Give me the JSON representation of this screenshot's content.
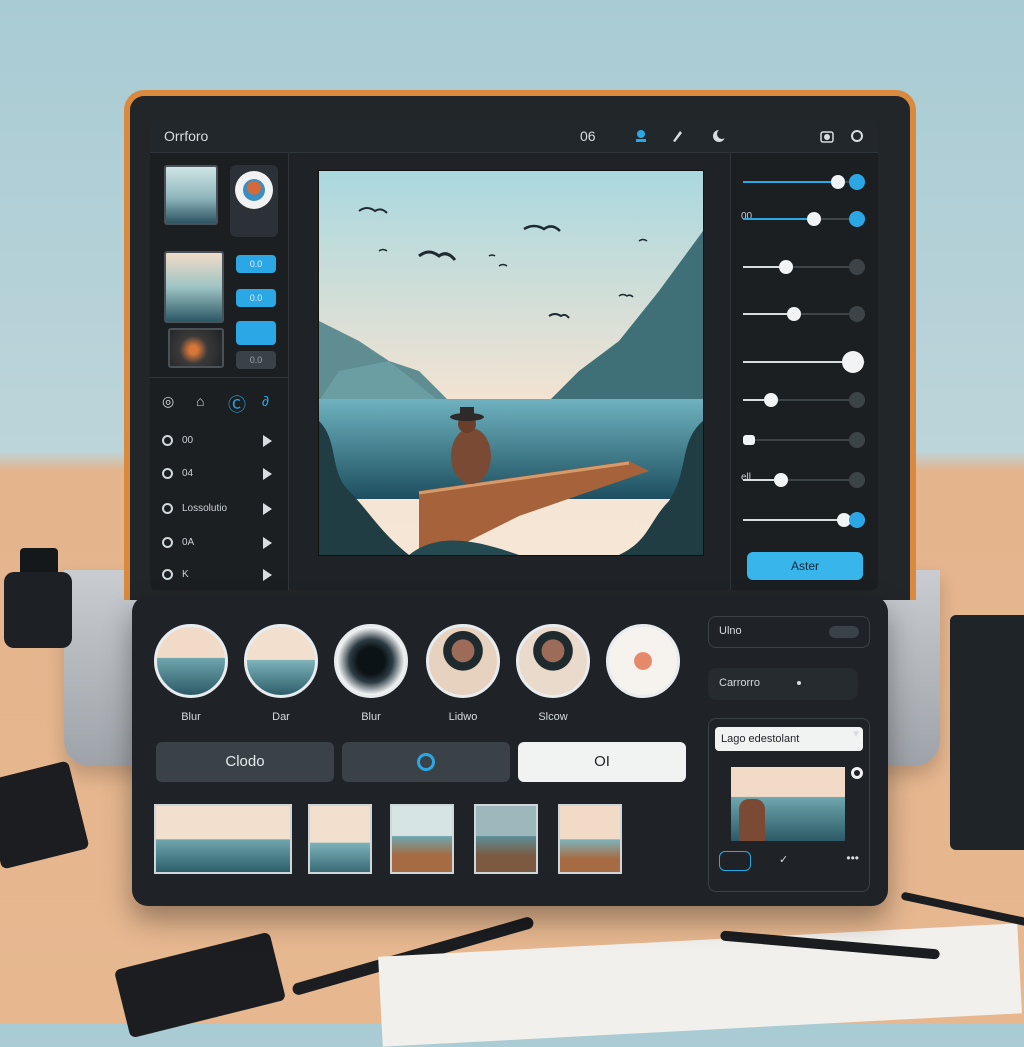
{
  "app": {
    "title": "Orrforo",
    "counter": "06"
  },
  "left_panel": {
    "pills": [
      "0.0",
      "0.0",
      "",
      "0.0"
    ],
    "list": [
      {
        "label": "00"
      },
      {
        "label": "04"
      },
      {
        "label": "Lossolutio"
      },
      {
        "label": "0A"
      },
      {
        "label": "K"
      }
    ]
  },
  "right_panel": {
    "sliders": [
      {
        "caption": "",
        "value": 0.85
      },
      {
        "caption": "00",
        "value": 0.62
      },
      {
        "caption": "",
        "value": 0.35
      },
      {
        "caption": "",
        "value": 0.42
      },
      {
        "caption": "",
        "value": 0.95
      },
      {
        "caption": "",
        "value": 0.2
      },
      {
        "caption": "",
        "value": 0.0
      },
      {
        "caption": "ell",
        "value": 0.3
      },
      {
        "caption": "",
        "value": 0.9
      }
    ],
    "apply_label": "Aster"
  },
  "filters": [
    {
      "label": "Blur"
    },
    {
      "label": "Dar"
    },
    {
      "label": "Blur"
    },
    {
      "label": "Lidwo"
    },
    {
      "label": "Slcow"
    },
    {
      "label": ""
    }
  ],
  "buttons": {
    "clodo": "Clodo",
    "ok": "OI"
  },
  "side": {
    "field1": "Ulno",
    "field2": "Carrorro",
    "dropdown": "Lago edestolant"
  },
  "colors": {
    "accent": "#2ca7e6",
    "panel": "#1f2327"
  }
}
